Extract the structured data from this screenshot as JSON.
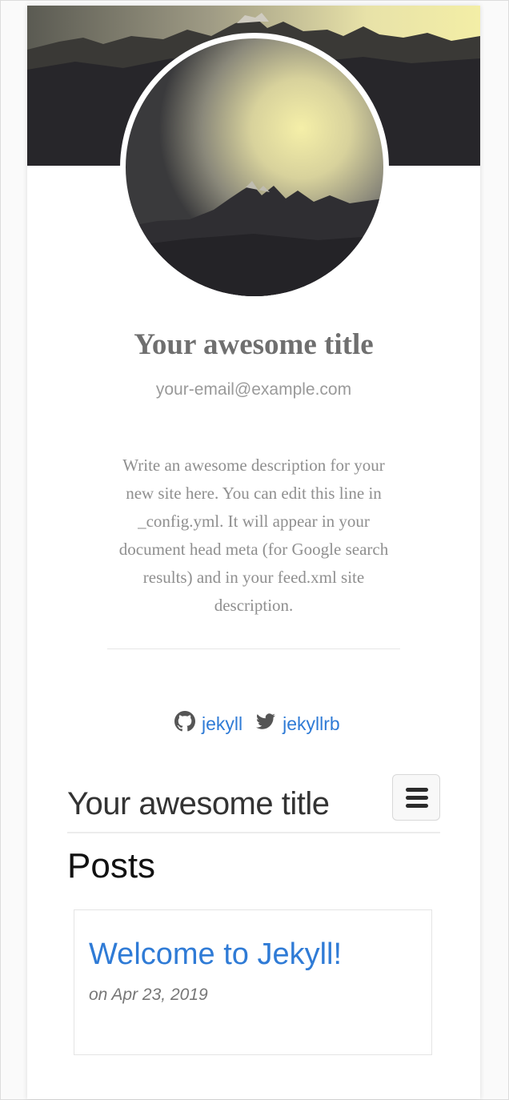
{
  "header": {
    "site_title": "Your awesome title",
    "email": "your-email@example.com",
    "description": "Write an awesome description for your new site here. You can edit this line in _config.yml. It will appear in your document head meta (for Google search results) and in your feed.xml site description."
  },
  "social": {
    "github": {
      "icon": "github-icon",
      "label": "jekyll"
    },
    "twitter": {
      "icon": "twitter-icon",
      "label": "jekyllrb"
    }
  },
  "nav": {
    "brand": "Your awesome title",
    "menu_icon": "hamburger-menu-icon"
  },
  "main": {
    "heading": "Posts",
    "posts": [
      {
        "title": "Welcome to Jekyll!",
        "date": "on Apr 23, 2019"
      }
    ]
  },
  "colors": {
    "link": "#2f7bd6",
    "title_gray": "#6f6f6f",
    "text_gray": "#8f8f8f"
  }
}
